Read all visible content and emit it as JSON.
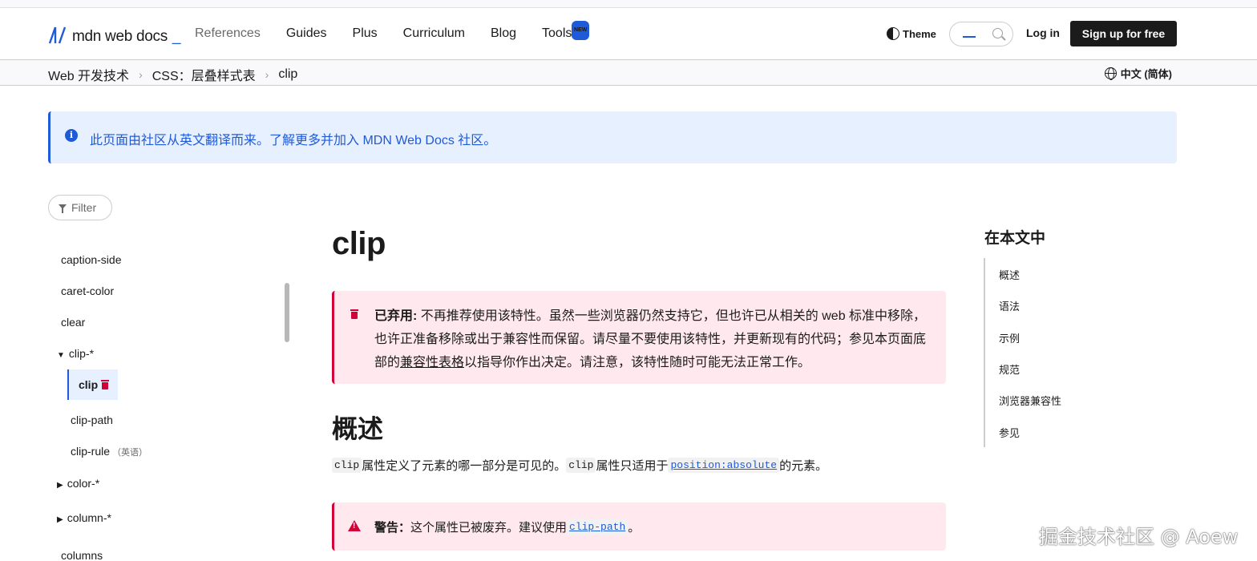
{
  "header": {
    "logo_text": "mdn web docs",
    "logo_cursor": "_",
    "nav": [
      "References",
      "Guides",
      "Plus",
      "Curriculum",
      "Blog",
      "Tools"
    ],
    "tools_badge": "NEW",
    "theme_label": "Theme",
    "search_value": "_",
    "login_label": "Log in",
    "signup_label": "Sign up for free"
  },
  "breadcrumb": {
    "items": [
      "Web 开发技术",
      "CSS：层叠样式表",
      "clip"
    ],
    "language": "中文 (简体)"
  },
  "notice": {
    "text": "此页面由社区从英文翻译而来。了解更多并加入 MDN Web Docs 社区。"
  },
  "sidebar": {
    "filter_placeholder": "Filter",
    "items": [
      {
        "label": "caption-side"
      },
      {
        "label": "caret-color"
      },
      {
        "label": "clear"
      },
      {
        "label": "clip-*",
        "marker": "▼"
      },
      {
        "label": "clip",
        "active": true
      },
      {
        "label": "clip-path"
      },
      {
        "label": "clip-rule",
        "note": "（英语）"
      },
      {
        "label": "color-*",
        "marker": "▶"
      },
      {
        "label": "column-*",
        "marker": "▶"
      },
      {
        "label": "columns"
      }
    ]
  },
  "main": {
    "title": "clip",
    "deprecated": {
      "label": "已弃用:",
      "text_1": " 不再推荐使用该特性。虽然一些浏览器仍然支持它，但也许已从相关的 web 标准中移除，也许正准备移除或出于兼容性而保留。请尽量不要使用该特性，并更新现有的代码；参见本页面底部的",
      "link": "兼容性表格",
      "text_2": "以指导你作出决定。请注意，该特性随时可能无法正常工作。"
    },
    "overview_heading": "概述",
    "overview": {
      "code_1": "clip",
      "text_1": " 属性定义了元素的哪一部分是可见的。",
      "code_2": "clip",
      "text_2": " 属性只适用于 ",
      "code_link": "position:absolute",
      "text_3": " 的元素。"
    },
    "warning": {
      "label": "警告：",
      "text": "这个属性已被废弃。建议使用 ",
      "code_link": "clip-path",
      "end": " 。"
    }
  },
  "toc": {
    "title": "在本文中",
    "items": [
      "概述",
      "语法",
      "示例",
      "规范",
      "浏览器兼容性",
      "参见"
    ]
  },
  "watermark": "掘金技术社区 @ Aoew",
  "colors": {
    "accent": "#1f5ad9",
    "danger": "#d30038",
    "notice_bg": "#e7f0ff",
    "danger_bg": "#ffe9ee"
  }
}
